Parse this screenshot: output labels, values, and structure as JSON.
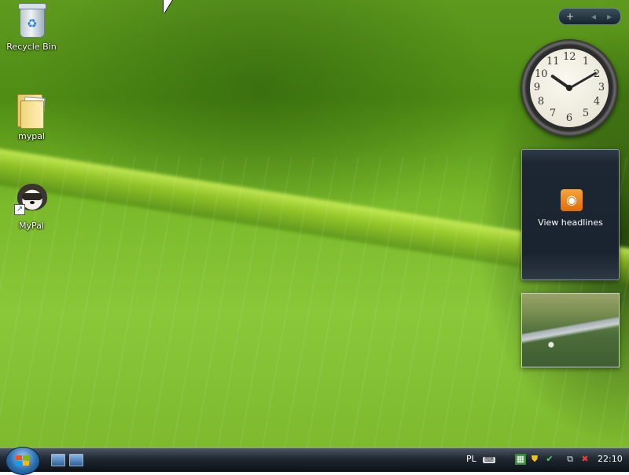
{
  "desktop": {
    "icons": [
      {
        "label": "Recycle Bin",
        "icon": "recycle-bin-icon"
      },
      {
        "label": "mypal",
        "icon": "folder-icon"
      },
      {
        "label": "MyPal",
        "icon": "mypal-raccoon-icon",
        "shortcut": true
      }
    ]
  },
  "sidebar": {
    "controls": {
      "add": "+",
      "prev": "◂",
      "next": "▸"
    },
    "clock": {
      "numbers": [
        "12",
        "1",
        "2",
        "3",
        "4",
        "5",
        "6",
        "7",
        "8",
        "9",
        "10",
        "11"
      ],
      "time_shown": "10:10"
    },
    "feed_gadget": {
      "label": "View headlines",
      "icon": "rss-icon"
    },
    "slideshow_gadget": {
      "icon": "landscape-photo"
    }
  },
  "taskbar": {
    "start_icon": "windows-logo-icon",
    "quick_launch": [
      "show-desktop-icon",
      "switch-windows-icon"
    ],
    "tray": {
      "language": "PL",
      "icons": [
        "keyboard-icon",
        "network-icon",
        "security-shield-icon",
        "check-icon",
        "network-connections-icon",
        "volume-muted-icon"
      ],
      "time": "22:10"
    }
  },
  "colors": {
    "taskbar": "#1f2730",
    "leaf_green": "#7eb92e",
    "rss_orange": "#e06d08"
  }
}
